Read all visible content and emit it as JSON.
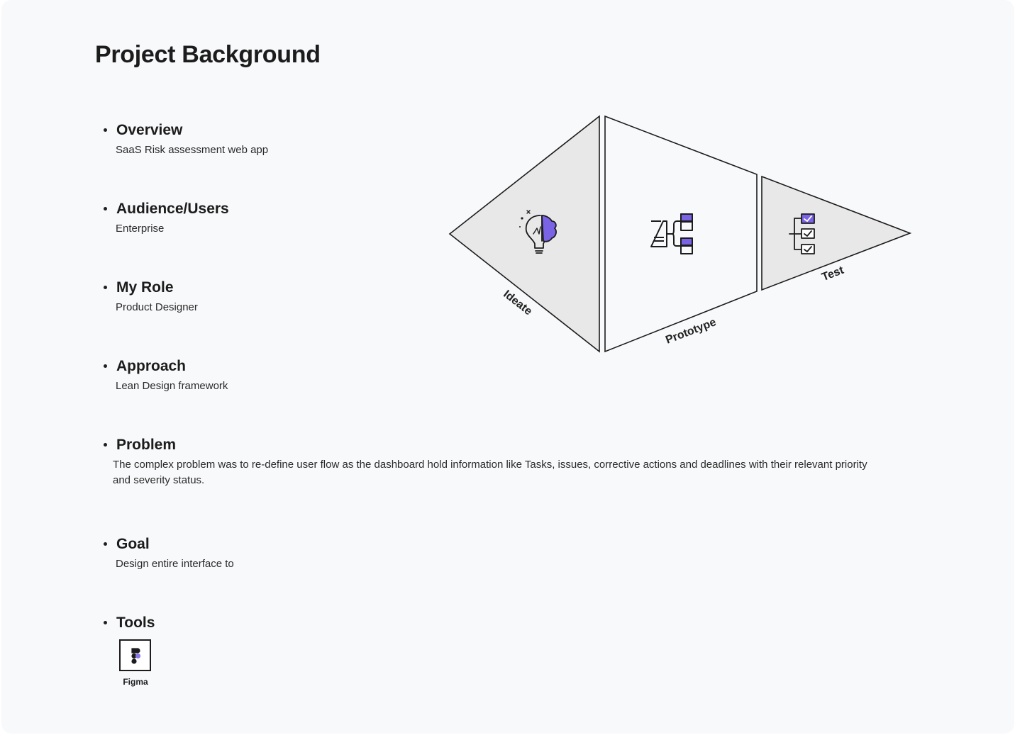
{
  "page": {
    "title": "Project Background"
  },
  "sections": {
    "overview": {
      "heading": "Overview",
      "body": "SaaS Risk assessment web app"
    },
    "audience": {
      "heading": "Audience/Users",
      "body": "Enterprise"
    },
    "role": {
      "heading": "My Role",
      "body": "Product Designer"
    },
    "approach": {
      "heading": "Approach",
      "body": "Lean Design framework"
    },
    "problem": {
      "heading": "Problem",
      "body": "The complex problem was to re-define user flow as the dashboard hold information like Tasks, issues, corrective actions and deadlines with their relevant priority and severity status."
    },
    "goal": {
      "heading": "Goal",
      "body": "Design entire interface to"
    },
    "tools": {
      "heading": "Tools",
      "items": [
        {
          "label": "Figma",
          "icon": "figma-logo"
        }
      ]
    }
  },
  "diagram": {
    "stages": [
      {
        "label": "Ideate",
        "icon": "lightbulb-brain-icon"
      },
      {
        "label": "Prototype",
        "icon": "flowchart-icon"
      },
      {
        "label": "Test",
        "icon": "checklist-icon"
      }
    ]
  },
  "colors": {
    "accent": "#7b63e6",
    "shaded_fill": "#e8e8e8",
    "background": "#f8f9fb",
    "text": "#1c1c1c"
  }
}
